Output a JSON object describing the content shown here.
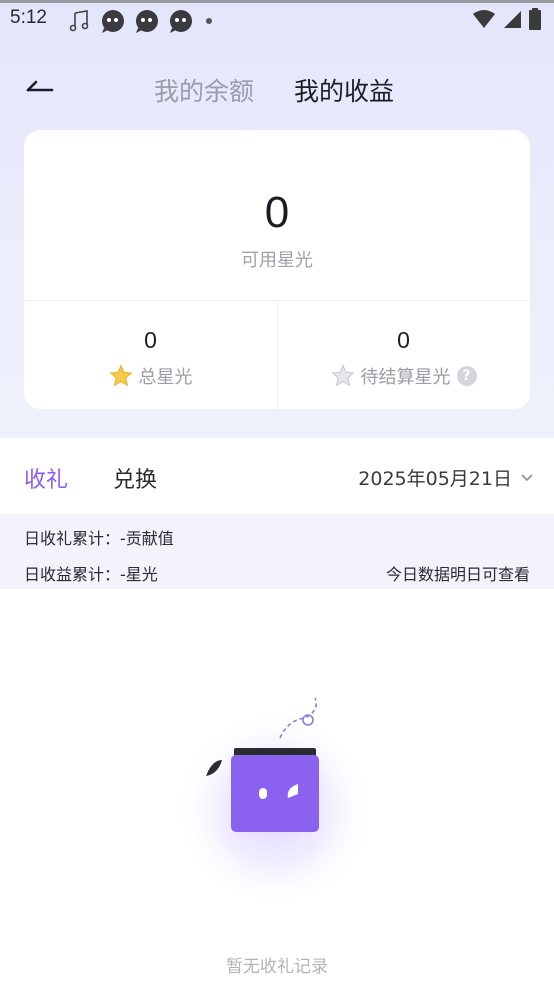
{
  "status_bar": {
    "time": "5:12",
    "left_icons": [
      "music-note-icon",
      "app-notification-icon",
      "app-notification-icon",
      "app-notification-icon",
      "dot-icon"
    ],
    "right_icons": [
      "wifi-icon",
      "signal-icon",
      "battery-icon"
    ]
  },
  "header": {
    "tabs": [
      {
        "label": "我的余额",
        "active": false
      },
      {
        "label": "我的收益",
        "active": true
      }
    ]
  },
  "card": {
    "available_value": "0",
    "available_label": "可用星光",
    "stats": [
      {
        "value": "0",
        "label": "总星光",
        "icon": "gold-star-icon"
      },
      {
        "value": "0",
        "label": "待结算星光",
        "icon": "grey-star-icon",
        "help": "?"
      }
    ]
  },
  "list_tabs": [
    {
      "label": "收礼",
      "active": true
    },
    {
      "label": "兑换",
      "active": false
    }
  ],
  "date_picker": {
    "value": "2025年05月21日"
  },
  "summary": {
    "gift_total": "日收礼累计：-贡献值",
    "earning_total": "日收益累计：-星光",
    "note": "今日数据明日可查看"
  },
  "empty_state": {
    "text": "暂无收礼记录"
  },
  "colors": {
    "accent": "#8b5cf6",
    "header_bg": "#e4e6fb",
    "summary_bg": "#f2f3fb"
  }
}
